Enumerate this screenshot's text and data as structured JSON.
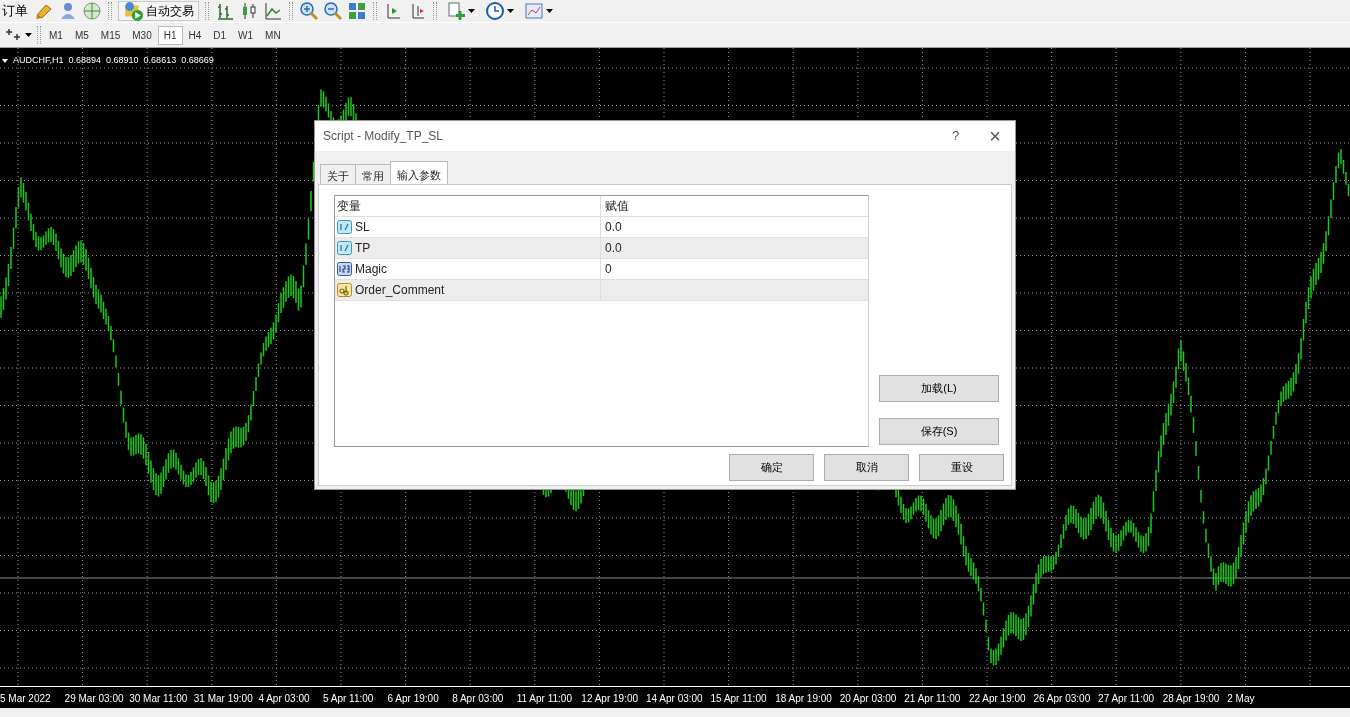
{
  "toolbar": {
    "label": "订单",
    "auto_trading": "自动交易"
  },
  "timeframes": [
    {
      "label": "M1",
      "selected": false
    },
    {
      "label": "M5",
      "selected": false
    },
    {
      "label": "M15",
      "selected": false
    },
    {
      "label": "M30",
      "selected": false
    },
    {
      "label": "H1",
      "selected": true
    },
    {
      "label": "H4",
      "selected": false
    },
    {
      "label": "D1",
      "selected": false
    },
    {
      "label": "W1",
      "selected": false
    },
    {
      "label": "MN",
      "selected": false
    }
  ],
  "chart": {
    "symbol": "AUDCHF,H1",
    "prices": [
      "0.68894",
      "0.68910",
      "0.68613",
      "0.68669"
    ],
    "time_labels": [
      "5 Mar 2022",
      "29 Mar 03:00",
      "30 Mar 11:00",
      "31 Mar 19:00",
      "4 Apr 03:00",
      "5 Apr 11:00",
      "6 Apr 19:00",
      "8 Apr 03:00",
      "11 Apr 11:00",
      "12 Apr 19:00",
      "14 Apr 03:00",
      "15 Apr 11:00",
      "18 Apr 19:00",
      "20 Apr 03:00",
      "21 Apr 11:00",
      "22 Apr 19:00",
      "26 Apr 03:00",
      "27 Apr 11:00",
      "28 Apr 19:00",
      "2 May"
    ]
  },
  "dialog": {
    "title": "Script - Modify_TP_SL",
    "help": "?",
    "close": "×",
    "tabs": [
      {
        "label": "关于",
        "selected": false
      },
      {
        "label": "常用",
        "selected": false
      },
      {
        "label": "输入参数",
        "selected": true
      }
    ],
    "table": {
      "columns": [
        "变量",
        "赋值"
      ],
      "rows": [
        {
          "kind": "double",
          "name": "SL",
          "value": "0.0"
        },
        {
          "kind": "double",
          "name": "TP",
          "value": "0.0"
        },
        {
          "kind": "int",
          "name": "Magic",
          "value": "0"
        },
        {
          "kind": "string",
          "name": "Order_Comment"
        }
      ]
    },
    "side_buttons": [
      "加载(L)",
      "保存(S)"
    ],
    "buttons": [
      "确定",
      "取消",
      "重设"
    ]
  }
}
